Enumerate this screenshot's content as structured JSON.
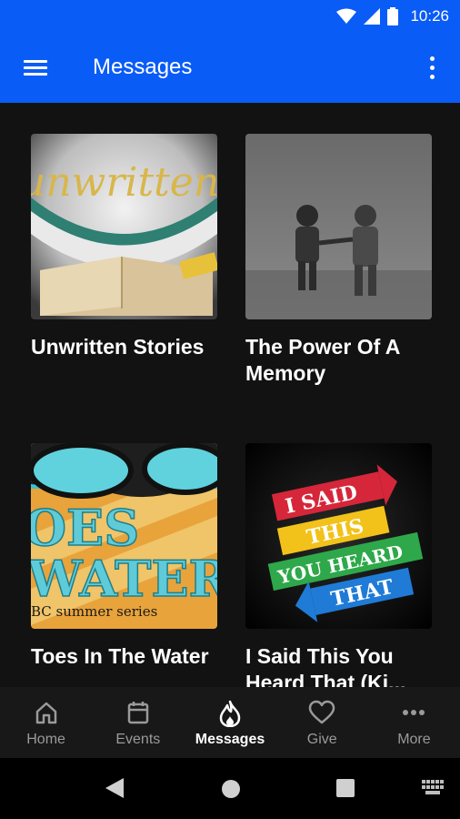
{
  "status_bar": {
    "time": "10:26"
  },
  "app_bar": {
    "title": "Messages"
  },
  "messages": [
    {
      "title": "Unwritten Stories",
      "art_text": "unwritten stories"
    },
    {
      "title": "The Power Of A Memory"
    },
    {
      "title": "Toes In The Water",
      "art_line1": "OES",
      "art_line2": "WATER",
      "art_caption": "BC summer series"
    },
    {
      "title": "I Said This You Heard That (Ki...",
      "art_banners": [
        "I SAID",
        "THIS",
        "YOU HEARD",
        "THAT"
      ]
    }
  ],
  "bottom_nav": {
    "active": "Messages",
    "tabs": [
      {
        "label": "Home",
        "icon": "home-icon"
      },
      {
        "label": "Events",
        "icon": "calendar-icon"
      },
      {
        "label": "Messages",
        "icon": "flame-icon"
      },
      {
        "label": "Give",
        "icon": "heart-icon"
      },
      {
        "label": "More",
        "icon": "more-horiz-icon"
      }
    ]
  },
  "colors": {
    "primary": "#0a5cf7",
    "background": "#121212",
    "nav": "#181818"
  }
}
